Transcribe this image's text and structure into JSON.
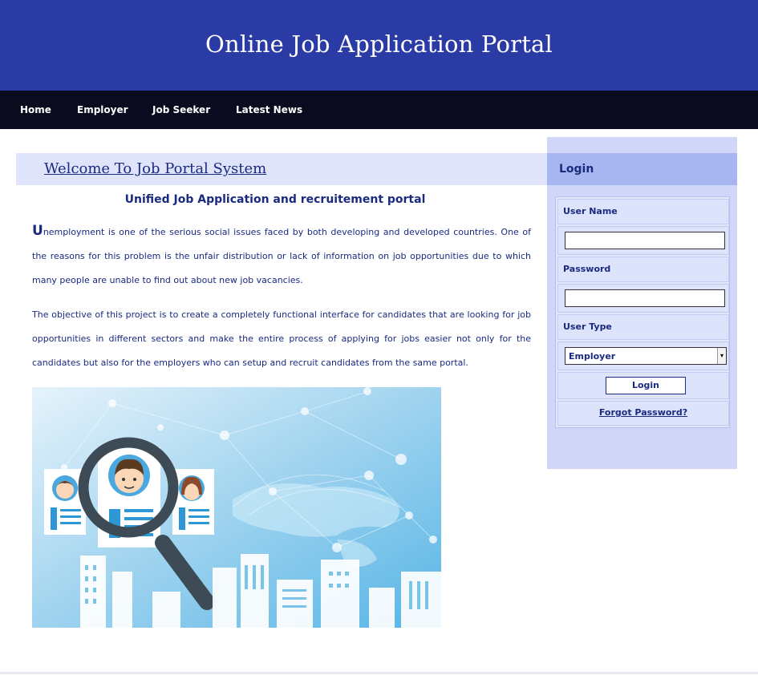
{
  "header": {
    "title": "Online Job Application Portal"
  },
  "nav": {
    "items": [
      "Home",
      "Employer",
      "Job Seeker",
      "Latest News"
    ]
  },
  "main": {
    "welcome_title": "Welcome To Job Portal System",
    "subtitle": "Unified Job Application and recruitement portal",
    "para1_first_letter": "U",
    "para1_rest": "nemployment is one of the serious social issues faced by both developing and developed countries. One of the reasons for this problem is the unfair distribution or lack of information on job opportunities due to which many people are unable to find out about new job vacancies.",
    "para2": "The objective of this project is to create a completely functional interface for candidates that are looking for job opportunities in different sectors and make the entire process of applying for jobs easier not only for the candidates but also for the employers who can setup and recruit candidates from the same portal."
  },
  "login": {
    "heading": "Login",
    "username_label": "User Name",
    "username_value": "",
    "password_label": "Password",
    "password_value": "",
    "usertype_label": "User Type",
    "usertype_selected": "Employer",
    "login_button": "Login",
    "forgot_link": "Forgot Password?"
  },
  "colors": {
    "header_bg": "#2b3ba6",
    "nav_bg": "#0b0b1f",
    "text_primary": "#1a2a80",
    "panel_bg": "#cfd6f8"
  }
}
